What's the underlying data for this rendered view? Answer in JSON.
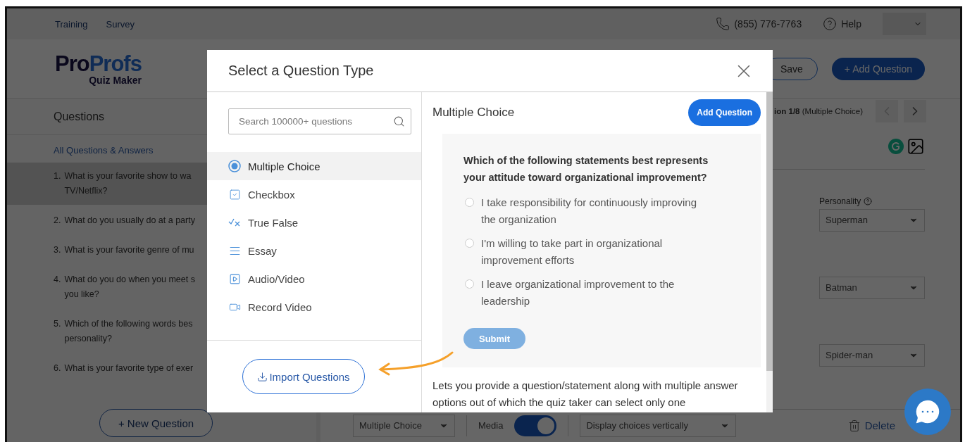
{
  "top_links": [
    "Training",
    "Survey"
  ],
  "phone": "(855) 776-7763",
  "help": "Help",
  "logo": {
    "part_a": "Pro",
    "part_b": "Profs",
    "product": "Quiz Maker"
  },
  "header_buttons": {
    "save": "Save",
    "add": "+ Add Question"
  },
  "sidebar": {
    "title": "Questions",
    "all_link": "All Questions & Answers",
    "items": [
      {
        "number": "1.",
        "text": "What is your favorite show to wa\nTV/Netflix?",
        "selected": true
      },
      {
        "number": "2.",
        "text": "What do you usually do at a party",
        "selected": false
      },
      {
        "number": "3.",
        "text": "What is your favorite genre of mu",
        "selected": false
      },
      {
        "number": "4.",
        "text": "What do you do when you meet s\nyou like?",
        "selected": false
      },
      {
        "number": "5.",
        "text": "Which of the following words bes\npersonality?",
        "selected": false
      },
      {
        "number": "6.",
        "text": "What is your favorite type of exer",
        "selected": false
      }
    ],
    "new_button": "+ New Question"
  },
  "editor": {
    "position": "ion 1/8",
    "type_note": "(Multiple Choice)",
    "outcome_label": "Personality",
    "outcomes": [
      "Superman",
      "Batman",
      "Spider-man"
    ],
    "toolbar": {
      "type_select": "Multiple Choice",
      "media_label": "Media",
      "media_on": true,
      "display_select": "Display choices vertically",
      "delete": "Delete"
    }
  },
  "modal": {
    "title": "Select a Question Type",
    "search_placeholder": "Search 100000+ questions",
    "types": [
      {
        "kind": "radio",
        "label": "Multiple Choice",
        "selected": true
      },
      {
        "kind": "checkbox",
        "label": "Checkbox",
        "selected": false
      },
      {
        "kind": "truefalse",
        "label": "True False",
        "selected": false
      },
      {
        "kind": "essay",
        "label": "Essay",
        "selected": false
      },
      {
        "kind": "media",
        "label": "Audio/Video",
        "selected": false
      },
      {
        "kind": "record",
        "label": "Record Video",
        "selected": false
      }
    ],
    "import_button": "Import Questions",
    "preview": {
      "heading": "Multiple Choice",
      "add_button": "Add Question",
      "question": "Which of the following statements best represents your attitude toward organizational improvement?",
      "options": [
        {
          "text": "I take responsibility for continuously improving the organization",
          "selected": false
        },
        {
          "text": "I'm willing to take part in organizational improvement efforts",
          "selected": false
        },
        {
          "text": "I leave organizational improvement to the leadership",
          "selected": false
        }
      ],
      "submit": "Submit"
    },
    "description": "Lets you provide a question/statement along with multiple answer options out of which the quiz taker can select only one"
  }
}
